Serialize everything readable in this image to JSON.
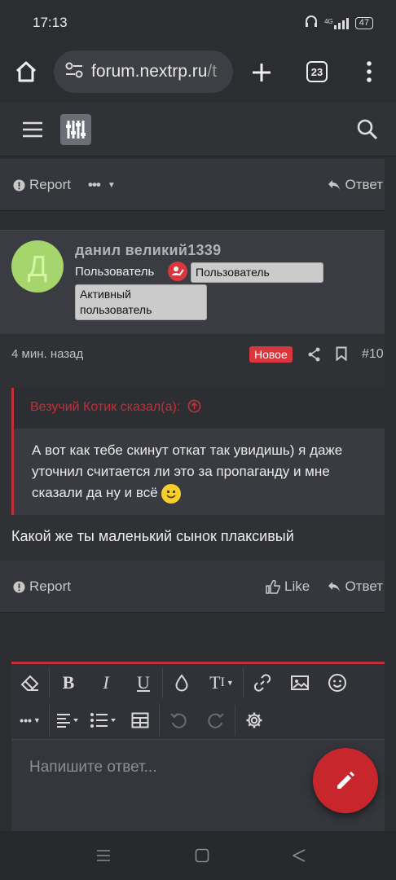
{
  "status": {
    "time": "17:13",
    "network": "4G",
    "battery": "47"
  },
  "browser": {
    "url_main": "forum.nextrp.ru",
    "url_tail": "/t",
    "tab_count": "23"
  },
  "top_actions": {
    "report": "Report",
    "reply": "Ответ"
  },
  "post": {
    "author": "данил великий1339",
    "role": "Пользователь",
    "tags": [
      "Пользователь",
      "Активный пользователь"
    ],
    "avatar_letter": "Д",
    "time_ago": "4 мин. назад",
    "new_badge": "Новое",
    "number": "#10",
    "quote_header": "Везучий Котик сказал(а):",
    "quote_text": "А вот как тебе скинут откат так увидишь) я даже уточнил считается ли это за пропаганду и мне сказали да ну и всё",
    "text": "Какой же ты маленький сынок плаксивый",
    "report": "Report",
    "like": "Like",
    "reply": "Ответ"
  },
  "editor": {
    "placeholder": "Напишите ответ..."
  },
  "colors": {
    "accent": "#c0303a",
    "avatar": "#a6d46d"
  }
}
